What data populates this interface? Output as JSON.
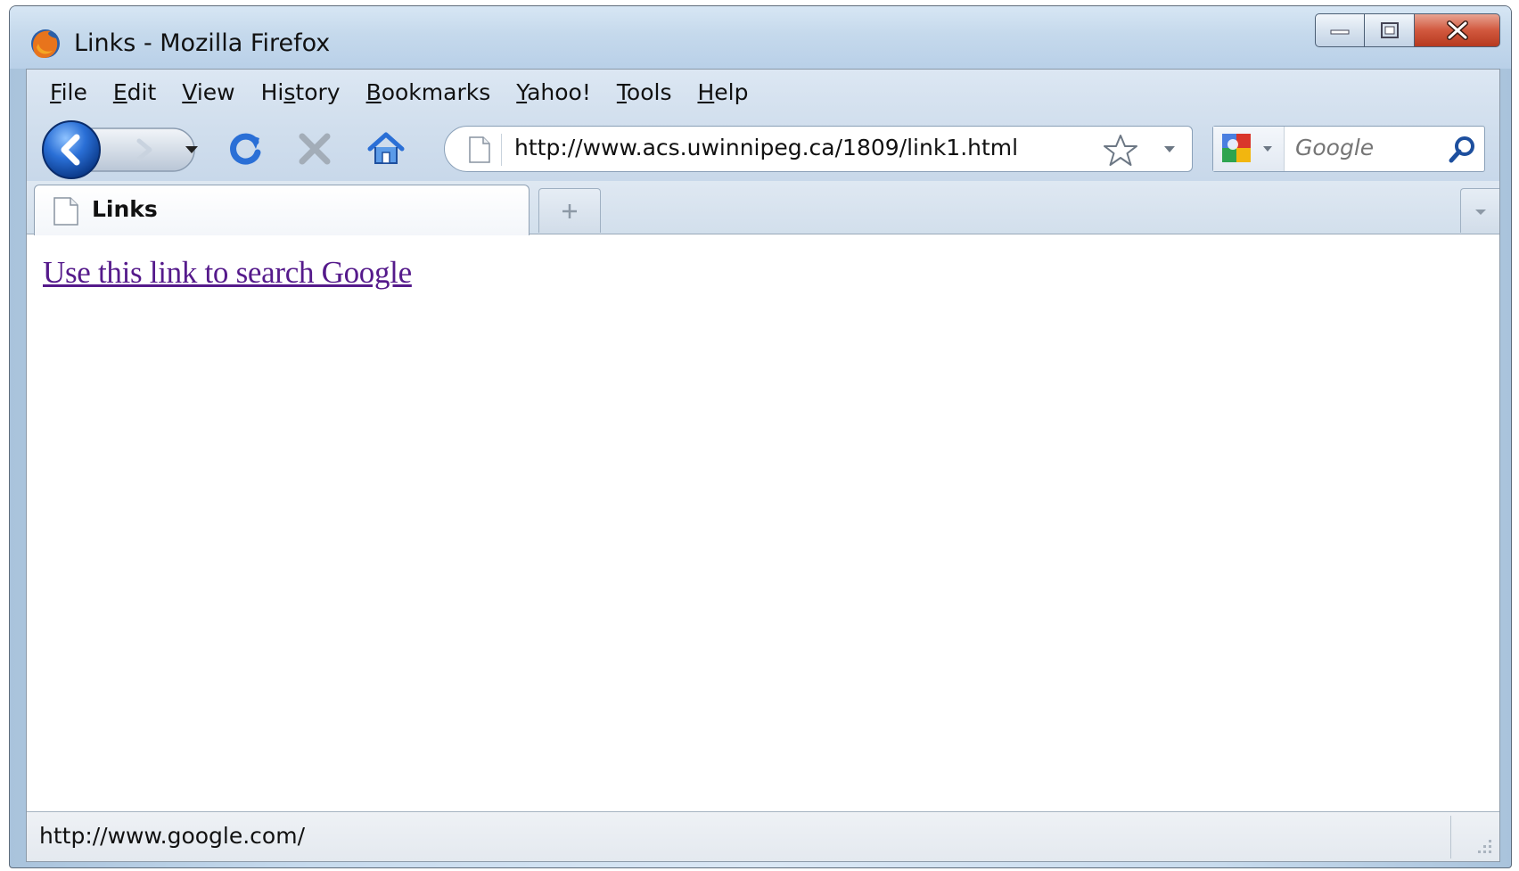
{
  "window": {
    "title": "Links - Mozilla Firefox"
  },
  "menubar": {
    "items": [
      {
        "label": "File",
        "access_key_index": 0
      },
      {
        "label": "Edit",
        "access_key_index": 0
      },
      {
        "label": "View",
        "access_key_index": 0
      },
      {
        "label": "History",
        "access_key_index": 2
      },
      {
        "label": "Bookmarks",
        "access_key_index": 0
      },
      {
        "label": "Yahoo!",
        "access_key_index": 0
      },
      {
        "label": "Tools",
        "access_key_index": 0
      },
      {
        "label": "Help",
        "access_key_index": 0
      }
    ]
  },
  "navbar": {
    "url": "http://www.acs.uwinnipeg.ca/1809/link1.html",
    "search_placeholder": "Google"
  },
  "tabs": [
    {
      "title": "Links",
      "selected": true
    }
  ],
  "page": {
    "link_text": "Use this link to search Google"
  },
  "statusbar": {
    "text": "http://www.google.com/"
  },
  "icons": {
    "app": "firefox-icon",
    "back": "back-arrow-icon",
    "forward": "forward-arrow-icon",
    "reload": "reload-icon",
    "stop": "stop-icon",
    "home": "home-icon",
    "page": "page-icon",
    "bookmark": "star-icon",
    "search_engine": "google-icon",
    "search": "magnifier-icon"
  },
  "colors": {
    "visited_link": "#551a8b",
    "chrome_blue": "#d3e0ee",
    "close_red": "#c8462b"
  }
}
